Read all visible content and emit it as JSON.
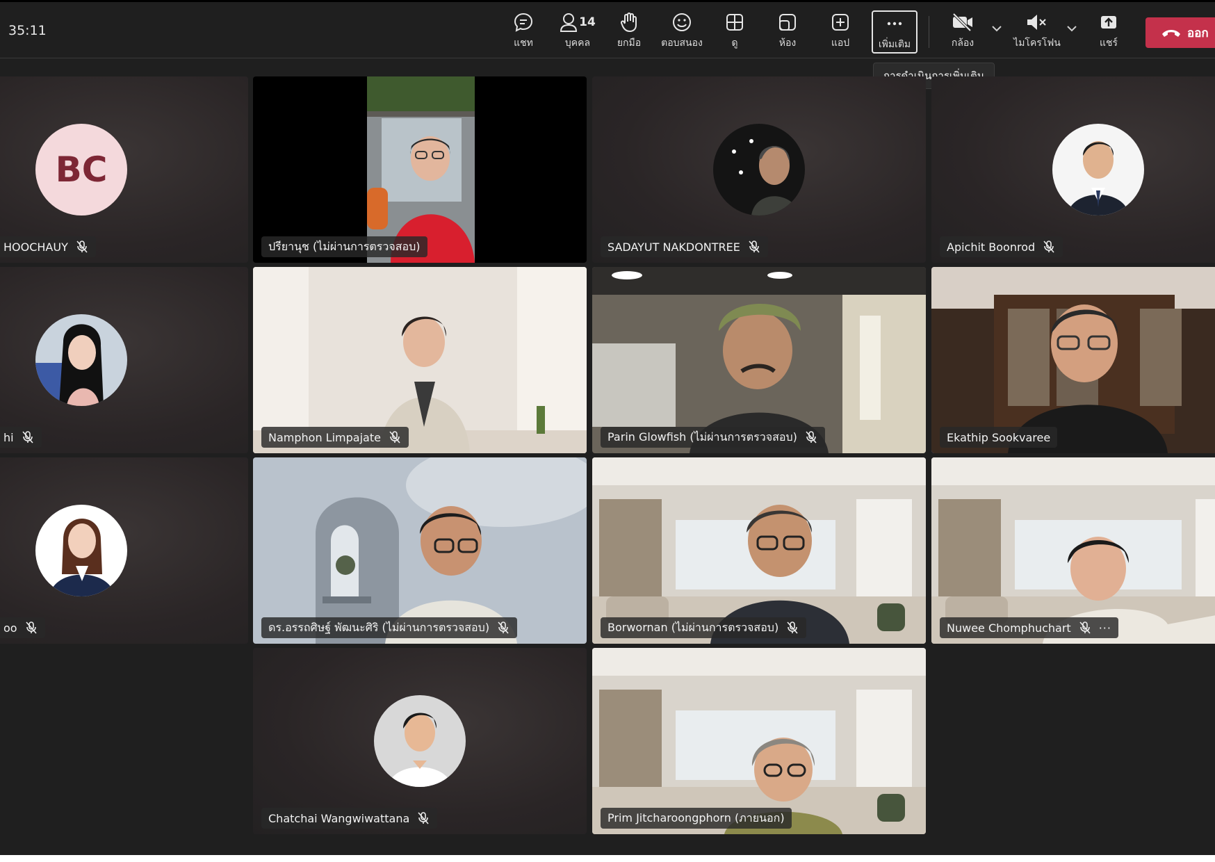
{
  "meeting": {
    "timer": "35:11"
  },
  "toolbar": {
    "chat": "แชท",
    "people": "บุคคล",
    "people_count": "14",
    "raise_hand": "ยกมือ",
    "react": "ตอบสนอง",
    "view": "ดู",
    "rooms": "ห้อง",
    "apps": "แอป",
    "more": "เพิ่มเติม",
    "camera": "กล้อง",
    "mic": "ไมโครโฟน",
    "share": "แชร์",
    "leave": "ออก",
    "more_tooltip": "การดำเนินการเพิ่มเติม"
  },
  "participants": [
    {
      "name": "HOOCHAUY",
      "initials": "BC",
      "muted": true
    },
    {
      "name": "ปรียานุช (ไม่ผ่านการตรวจสอบ)",
      "muted": false
    },
    {
      "name": "SADAYUT NAKDONTREE",
      "muted": true
    },
    {
      "name": "Apichit Boonrod",
      "muted": true
    },
    {
      "name": "hi",
      "muted": true
    },
    {
      "name": "Namphon Limpajate",
      "muted": true
    },
    {
      "name": "Parin Glowfish (ไม่ผ่านการตรวจสอบ)",
      "muted": true
    },
    {
      "name": "Ekathip Sookvaree",
      "muted": false,
      "speaking": true
    },
    {
      "name": "oo",
      "muted": true
    },
    {
      "name": "ดร.อรรถศิษฐ์ พัฒนะศิริ (ไม่ผ่านการตรวจสอบ)",
      "muted": true
    },
    {
      "name": "Borwornan (ไม่ผ่านการตรวจสอบ)",
      "muted": true
    },
    {
      "name": "Nuwee Chomphuchart",
      "muted": true,
      "more": "···"
    },
    {
      "name": "Chatchai Wangwiwattana",
      "muted": true
    },
    {
      "name": "Prim Jitcharoongphorn (ภายนอก)",
      "muted": false
    }
  ],
  "colors": {
    "leave": "#c4314b",
    "active_speaker": "#7f85f5",
    "avatar_bg": "#f4d9dc"
  }
}
